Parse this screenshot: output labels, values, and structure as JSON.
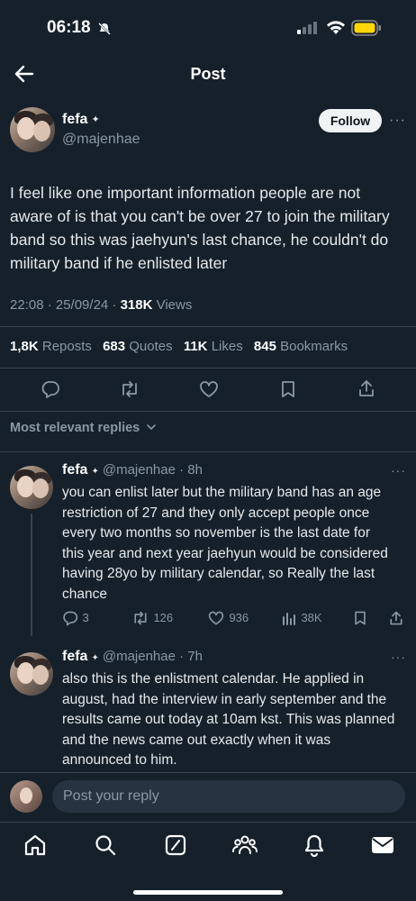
{
  "status": {
    "time": "06:18"
  },
  "header": {
    "title": "Post"
  },
  "post": {
    "author_name": "fefa",
    "author_handle": "@majenhae",
    "follow_label": "Follow",
    "text": "I feel like one important information people are not aware of is that you can't be over 27 to join the military band so this was jaehyun's last chance, he couldn't do military band if he enlisted later",
    "meta_time": "22:08 · 25/09/24 · ",
    "meta_views_count": "318K",
    "meta_views_label": " Views",
    "stats": {
      "reposts_count": "1,8K",
      "reposts_label": "Reposts",
      "quotes_count": "683",
      "quotes_label": "Quotes",
      "likes_count": "11K",
      "likes_label": "Likes",
      "bookmarks_count": "845",
      "bookmarks_label": "Bookmarks"
    }
  },
  "replies_filter": "Most relevant replies",
  "replies": [
    {
      "name": "fefa",
      "handle_time": "@majenhae · 8h",
      "text": "you can enlist later but the military band has an age restriction of 27 and they only accept people once every two months so november is the last date for this year and next year jaehyun would be considered having 28yo by military calendar, so Really the last chance",
      "replies": "3",
      "reposts": "126",
      "likes": "936",
      "views": "38K"
    },
    {
      "name": "fefa",
      "handle_time": "@majenhae · 7h",
      "text": "also this is the enlistment calendar. He applied in august, had the interview in early september and the results came out today at 10am kst. This was planned and the news came out exactly when it was announced to him."
    }
  ],
  "compose": {
    "placeholder": "Post your reply"
  },
  "colors": {
    "background": "#15202b",
    "muted": "#8b98a5",
    "divider": "#38444d",
    "battery": "#ffd60a"
  }
}
